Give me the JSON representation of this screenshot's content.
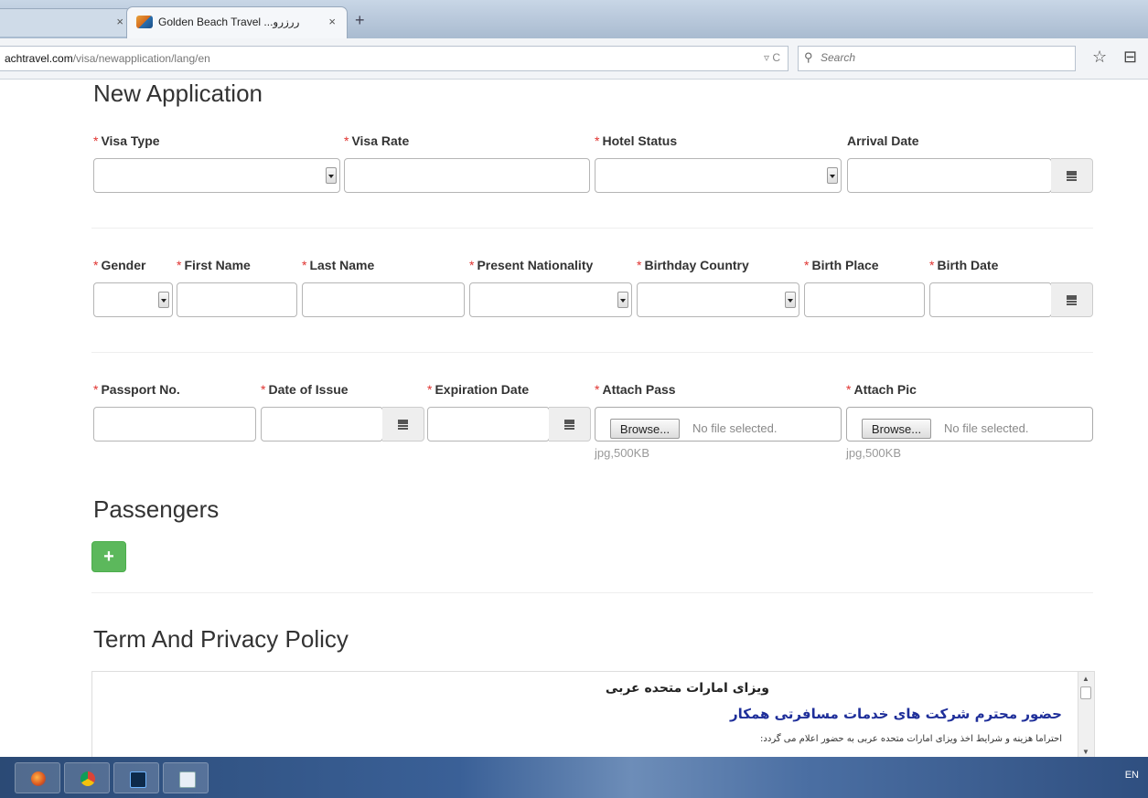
{
  "browser": {
    "inactive_tab_close": "×",
    "active_tab_title": "Golden Beach Travel ...ررزرو",
    "active_tab_close": "×",
    "new_tab": "+",
    "url_domain": "achtravel.com",
    "url_path": "/visa/newapplication/lang/en",
    "url_icons": "▿ C",
    "search_placeholder": "Search",
    "bookmark_icon": "☆",
    "reader_icon": "⊟"
  },
  "form": {
    "title": "New Application",
    "required_mark": "*",
    "row1": {
      "visa_type": "Visa Type",
      "visa_rate": "Visa Rate",
      "hotel_status": "Hotel Status",
      "arrival_date": "Arrival Date"
    },
    "row2": {
      "gender": "Gender",
      "first_name": "First Name",
      "last_name": "Last Name",
      "present_nationality": "Present Nationality",
      "birthday_country": "Birthday Country",
      "birth_place": "Birth Place",
      "birth_date": "Birth Date"
    },
    "row3": {
      "passport_no": "Passport No.",
      "date_of_issue": "Date of Issue",
      "expiration_date": "Expiration Date",
      "attach_pass": "Attach Pass",
      "attach_pic": "Attach Pic",
      "browse": "Browse...",
      "no_file": "No file selected.",
      "file_hint": "jpg,500KB"
    }
  },
  "passengers": {
    "title": "Passengers",
    "add_label": "+"
  },
  "terms": {
    "title": "Term And Privacy Policy",
    "line1": "ویزای امارات متحده عربی",
    "line2": "حضور محترم شرکت های خدمات مسافرتی همکار",
    "line3": "احتراما هزینه و شرایط اخذ ویزای امارات متحده عربی به حضور اعلام می گردد:"
  },
  "taskbar": {
    "tray_text": "EN"
  },
  "colors": {
    "required": "#e0322f",
    "add_button": "#5cb85c",
    "terms_heading": "#1f2f9a"
  }
}
